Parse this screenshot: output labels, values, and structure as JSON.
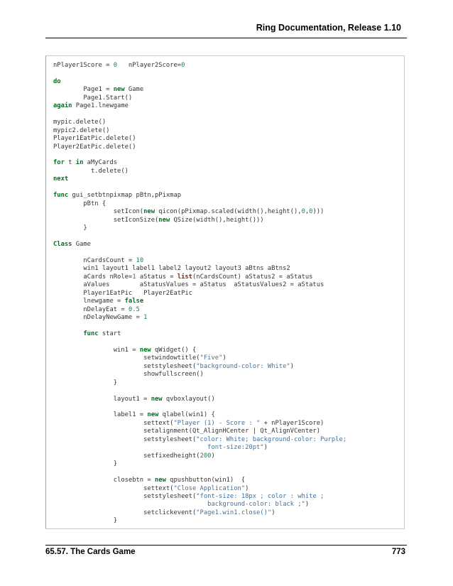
{
  "header": {
    "title": "Ring Documentation, Release 1.10"
  },
  "code": {
    "lines": [
      [
        {
          "t": "nPlayer1Score = "
        },
        {
          "t": "0",
          "c": "n"
        },
        {
          "t": "   nPlayer2Score="
        },
        {
          "t": "0",
          "c": "n"
        }
      ],
      [],
      [
        {
          "t": "do",
          "c": "k"
        }
      ],
      [
        {
          "t": "        Page1 = "
        },
        {
          "t": "new",
          "c": "k"
        },
        {
          "t": " Game"
        }
      ],
      [
        {
          "t": "        Page1.Start()"
        }
      ],
      [
        {
          "t": "again",
          "c": "k"
        },
        {
          "t": " Page1.lnewgame"
        }
      ],
      [],
      [
        {
          "t": "mypic.delete()"
        }
      ],
      [
        {
          "t": "mypic2.delete()"
        }
      ],
      [
        {
          "t": "Player1EatPic.delete()"
        }
      ],
      [
        {
          "t": "Player2EatPic.delete()"
        }
      ],
      [],
      [
        {
          "t": "for",
          "c": "k"
        },
        {
          "t": " t "
        },
        {
          "t": "in",
          "c": "k"
        },
        {
          "t": " aMyCards"
        }
      ],
      [
        {
          "t": "          t.delete()"
        }
      ],
      [
        {
          "t": "next",
          "c": "k"
        }
      ],
      [],
      [
        {
          "t": "func",
          "c": "k"
        },
        {
          "t": " gui_setbtnpixmap pBtn,pPixmap"
        }
      ],
      [
        {
          "t": "        pBtn {"
        }
      ],
      [
        {
          "t": "                setIcon("
        },
        {
          "t": "new",
          "c": "k"
        },
        {
          "t": " qicon(pPixmap.scaled(width(),height(),"
        },
        {
          "t": "0",
          "c": "n"
        },
        {
          "t": ","
        },
        {
          "t": "0",
          "c": "n"
        },
        {
          "t": ")))"
        }
      ],
      [
        {
          "t": "                setIconSize("
        },
        {
          "t": "new",
          "c": "k"
        },
        {
          "t": " QSize(width(),height()))"
        }
      ],
      [
        {
          "t": "        }"
        }
      ],
      [],
      [
        {
          "t": "Class",
          "c": "k"
        },
        {
          "t": " Game"
        }
      ],
      [],
      [
        {
          "t": "        nCardsCount = "
        },
        {
          "t": "10",
          "c": "n"
        }
      ],
      [
        {
          "t": "        win1 layout1 label1 label2 layout2 layout3 aBtns aBtns2"
        }
      ],
      [
        {
          "t": "        aCards nRole="
        },
        {
          "t": "1",
          "c": "n"
        },
        {
          "t": " aStatus = "
        },
        {
          "t": "list",
          "c": "b"
        },
        {
          "t": "(nCardsCount) aStatus2 = aStatus"
        }
      ],
      [
        {
          "t": "        aValues        aStatusValues = aStatus  aStatusValues2 = aStatus"
        }
      ],
      [
        {
          "t": "        Player1EatPic   Player2EatPic"
        }
      ],
      [
        {
          "t": "        lnewgame = "
        },
        {
          "t": "false",
          "c": "k"
        }
      ],
      [
        {
          "t": "        nDelayEat = "
        },
        {
          "t": "0.5",
          "c": "n"
        }
      ],
      [
        {
          "t": "        nDelayNewGame = "
        },
        {
          "t": "1",
          "c": "n"
        }
      ],
      [],
      [
        {
          "t": "        "
        },
        {
          "t": "func",
          "c": "k"
        },
        {
          "t": " start"
        }
      ],
      [],
      [
        {
          "t": "                win1 = "
        },
        {
          "t": "new",
          "c": "k"
        },
        {
          "t": " qWidget() {"
        }
      ],
      [
        {
          "t": "                        setwindowtitle("
        },
        {
          "t": "\"Five\"",
          "c": "s"
        },
        {
          "t": ")"
        }
      ],
      [
        {
          "t": "                        setstylesheet("
        },
        {
          "t": "\"background-color: White\"",
          "c": "s"
        },
        {
          "t": ")"
        }
      ],
      [
        {
          "t": "                        showfullscreen()"
        }
      ],
      [
        {
          "t": "                }"
        }
      ],
      [],
      [
        {
          "t": "                layout1 = "
        },
        {
          "t": "new",
          "c": "k"
        },
        {
          "t": " qvboxlayout()"
        }
      ],
      [],
      [
        {
          "t": "                label1 = "
        },
        {
          "t": "new",
          "c": "k"
        },
        {
          "t": " qlabel(win1) {"
        }
      ],
      [
        {
          "t": "                        settext("
        },
        {
          "t": "\"Player (1) - Score : \"",
          "c": "s"
        },
        {
          "t": " + nPlayer1Score)"
        }
      ],
      [
        {
          "t": "                        setalignment(Qt_AlignHCenter | Qt_AlignVCenter)"
        }
      ],
      [
        {
          "t": "                        setstylesheet("
        },
        {
          "t": "\"color: White; background-color: Purple;",
          "c": "s"
        }
      ],
      [
        {
          "t": "                                         font-size:20pt\"",
          "c": "s"
        },
        {
          "t": ")"
        }
      ],
      [
        {
          "t": "                        setfixedheight("
        },
        {
          "t": "200",
          "c": "n"
        },
        {
          "t": ")"
        }
      ],
      [
        {
          "t": "                }"
        }
      ],
      [],
      [
        {
          "t": "                closebtn = "
        },
        {
          "t": "new",
          "c": "k"
        },
        {
          "t": " qpushbutton(win1)  {"
        }
      ],
      [
        {
          "t": "                        settext("
        },
        {
          "t": "\"Close Application\"",
          "c": "s"
        },
        {
          "t": ")"
        }
      ],
      [
        {
          "t": "                        setstylesheet("
        },
        {
          "t": "\"font-size: 18px ; color : white ;",
          "c": "s"
        }
      ],
      [
        {
          "t": "                                         background-color: black ;\"",
          "c": "s"
        },
        {
          "t": ")"
        }
      ],
      [
        {
          "t": "                        setclickevent("
        },
        {
          "t": "\"Page1.win1.close()\"",
          "c": "s"
        },
        {
          "t": ")"
        }
      ],
      [
        {
          "t": "                }"
        }
      ]
    ]
  },
  "footer": {
    "section": "65.57. The Cards Game",
    "page_number": "773"
  }
}
